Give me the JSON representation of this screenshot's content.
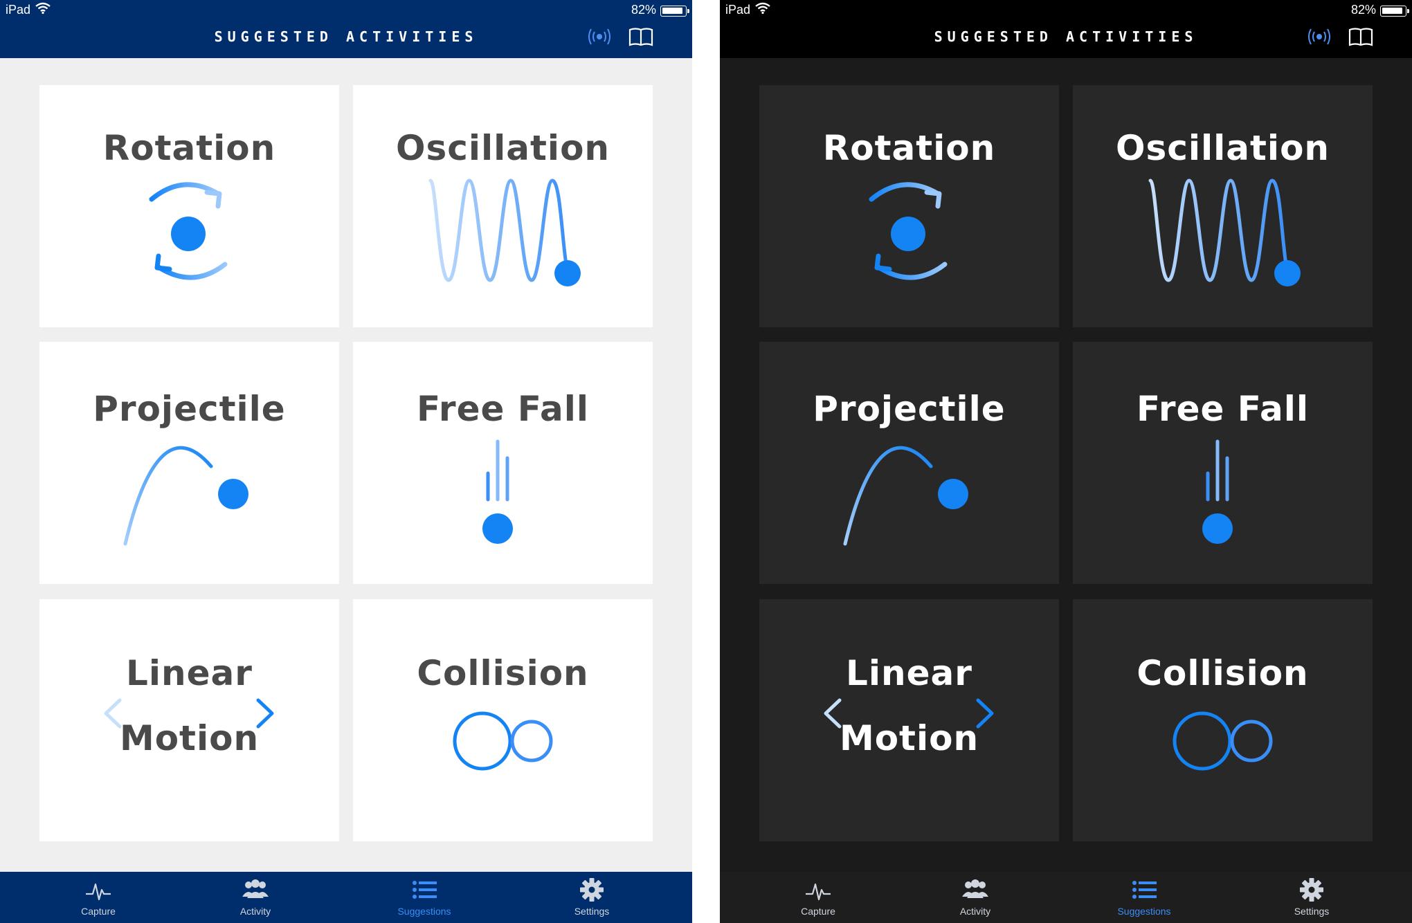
{
  "status": {
    "device": "iPad",
    "battery": "82%",
    "battery_level": 0.82
  },
  "nav": {
    "title": "SUGGESTED ACTIVITIES"
  },
  "activities": [
    {
      "label": "Rotation",
      "icon": "rotation-icon"
    },
    {
      "label": "Oscillation",
      "icon": "oscillation-icon"
    },
    {
      "label": "Projectile",
      "icon": "projectile-icon"
    },
    {
      "label": "Free Fall",
      "icon": "free-fall-icon"
    },
    {
      "label_line1": "Linear",
      "label_line2": "Motion",
      "icon": "linear-motion-icon"
    },
    {
      "label": "Collision",
      "icon": "collision-icon"
    }
  ],
  "tabs": [
    {
      "label": "Capture",
      "icon": "pulse-icon"
    },
    {
      "label": "Activity",
      "icon": "people-icon"
    },
    {
      "label": "Suggestions",
      "icon": "list-icon",
      "active": true
    },
    {
      "label": "Settings",
      "icon": "gear-icon"
    }
  ],
  "colors": {
    "accent": "#1484f5",
    "light_nav": "#002d6b",
    "dark_nav": "#000000",
    "active_tab": "#3a8ef6"
  }
}
